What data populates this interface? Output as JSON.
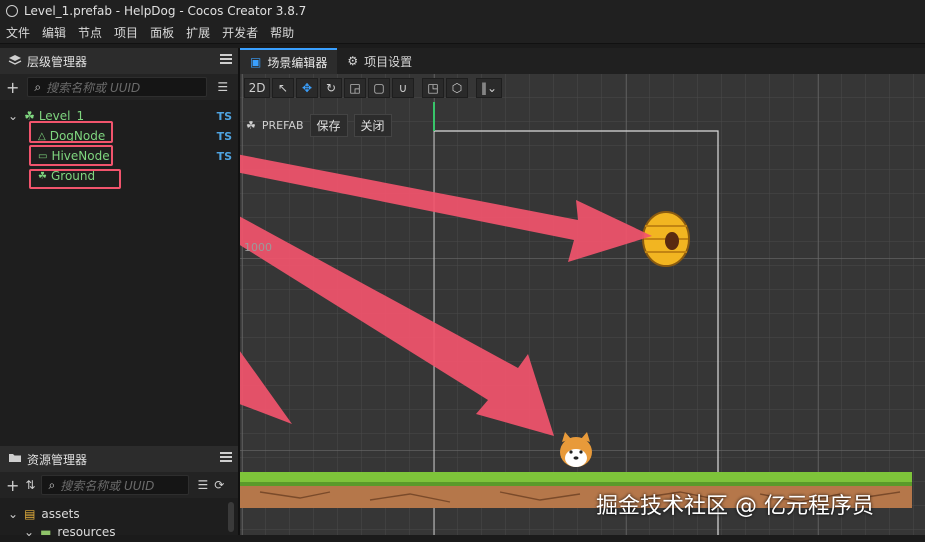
{
  "window": {
    "title": "Level_1.prefab - HelpDog - Cocos Creator 3.8.7"
  },
  "menu": [
    "文件",
    "编辑",
    "节点",
    "项目",
    "面板",
    "扩展",
    "开发者",
    "帮助"
  ],
  "hierarchy": {
    "title": "层级管理器",
    "search_placeholder": "搜索名称或 UUID",
    "root": "Level_1",
    "root_badge": "TS",
    "children": [
      {
        "name": "DogNode",
        "badge": "TS"
      },
      {
        "name": "HiveNode",
        "badge": "TS"
      },
      {
        "name": "Ground",
        "badge": ""
      }
    ]
  },
  "assets": {
    "title": "资源管理器",
    "search_placeholder": "搜索名称或 UUID",
    "items": [
      "assets",
      "resources"
    ]
  },
  "tabs": [
    {
      "label": "场景编辑器"
    },
    {
      "label": "项目设置"
    }
  ],
  "scene": {
    "mode_label": "2D",
    "prefab_label": "PREFAB",
    "save_label": "保存",
    "close_label": "关闭",
    "grid_label": "1000"
  },
  "watermark": "掘金技术社区 @ 亿元程序员",
  "colors": {
    "accent": "#3aa0ff",
    "highlight": "#f2546d",
    "node_green": "#7fd67f",
    "ts_blue": "#4fa3e0"
  }
}
